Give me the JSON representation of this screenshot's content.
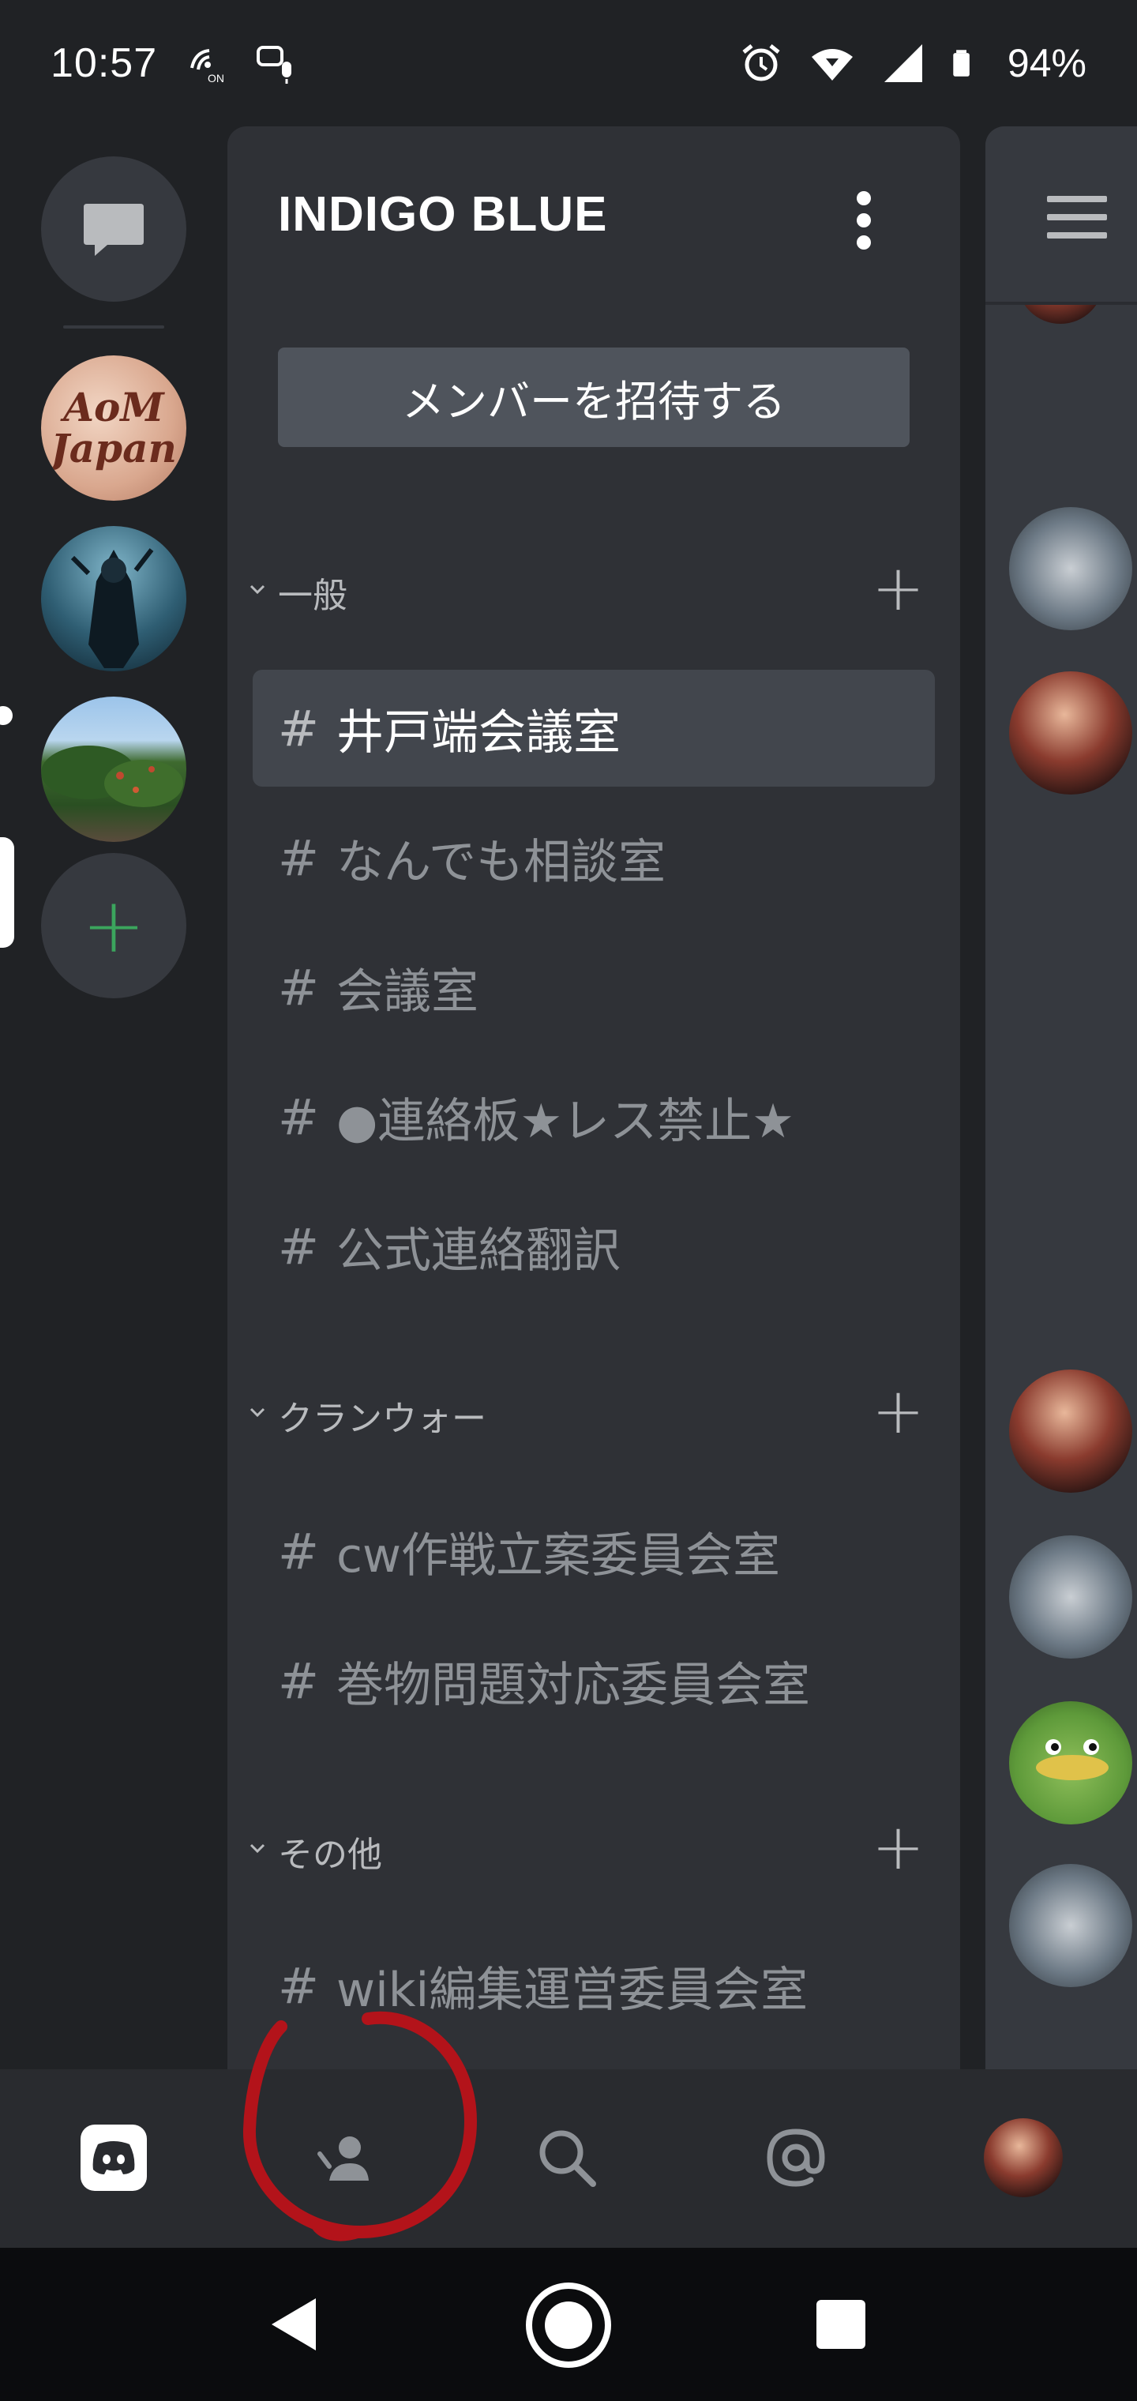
{
  "status_bar": {
    "time": "10:57",
    "battery": "94%",
    "icons": [
      "nfc-on-icon",
      "voice-notify-icon",
      "alarm-icon",
      "wifi-icon",
      "signal-icon",
      "battery-icon"
    ]
  },
  "server_rail": {
    "dm_icon": "chat-bubble-icon",
    "servers": [
      {
        "name": "AoM Japan",
        "avatar_text": "AoM Japan",
        "unread": false
      },
      {
        "name": "assassin-avatar",
        "unread": true
      },
      {
        "name": "tree-avatar",
        "selected": true
      }
    ],
    "add_server_label": "+"
  },
  "channel_panel": {
    "server_name": "INDIGO BLUE",
    "invite_button": "メンバーを招待する",
    "categories": [
      {
        "name": "一般",
        "channels": [
          "井戸端会議室",
          "なんでも相談室",
          "会議室",
          "●連絡板★レス禁止★",
          "公式連絡翻訳"
        ],
        "selected_index": 0
      },
      {
        "name": "クランウォー",
        "channels": [
          "cw作戦立案委員会室",
          "巻物問題対応委員会室"
        ]
      },
      {
        "name": "その他",
        "channels": [
          "wiki編集運営委員会室"
        ]
      }
    ],
    "hash": "#",
    "add": "+"
  },
  "right_pane": {
    "menu_icon": "hamburger-icon",
    "avatars": [
      "person",
      "truck",
      "person",
      "person",
      "truck",
      "duck",
      "truck"
    ]
  },
  "bottom_nav": {
    "items": [
      "home-icon",
      "friends-icon",
      "search-icon",
      "mentions-icon",
      "profile-avatar"
    ],
    "annotation": "red-circle-around-friends"
  },
  "android_nav": {
    "items": [
      "back-icon",
      "home-icon",
      "recents-icon"
    ]
  },
  "colors": {
    "background": "#202225",
    "panel": "#2f3136",
    "selected_channel": "#42464d",
    "invite_button": "#4f545c",
    "add_server_green": "#3ba55d",
    "annotation_red": "#b3131a"
  }
}
